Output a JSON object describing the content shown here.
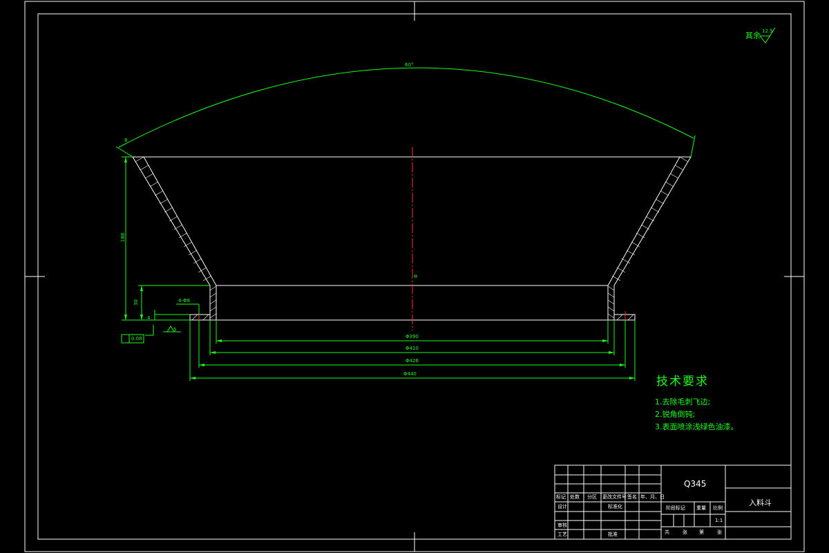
{
  "roughness": {
    "label": "其余",
    "value": "12.5"
  },
  "tech_requirements": {
    "title": "技术要求",
    "items": [
      "1.去除毛刺飞边;",
      "2.锐角倒钝;",
      "3.表面喷涂浅绿色油漆。"
    ]
  },
  "dimensions": {
    "angle": "60°",
    "height": "188",
    "flange_height": "30",
    "thickness": "8",
    "flange_thickness": "4",
    "hole": "4-Φ8",
    "d_inner": "Φ390",
    "d_1": "Φ410",
    "d_2": "Φ426",
    "d_outer": "Φ440",
    "weld_symbol": "5",
    "flatness": "0.08"
  },
  "title_block": {
    "material": "Q345",
    "part_name": "入料斗",
    "scale": "1:1",
    "header_labels": [
      "标记",
      "处数",
      "分区",
      "更改文件号",
      "签名",
      "年、月、日"
    ],
    "row_labels": [
      "设计",
      "标准化",
      "审核",
      "工艺",
      "批准"
    ],
    "stage_labels": [
      "阶段标记",
      "重量",
      "比例"
    ],
    "sheet_labels": [
      "共",
      "张",
      "第",
      "张"
    ]
  },
  "colors": {
    "line": "#ffffff",
    "dimension": "#19ff19",
    "centerline": "#ff3030",
    "background": "#000000"
  }
}
